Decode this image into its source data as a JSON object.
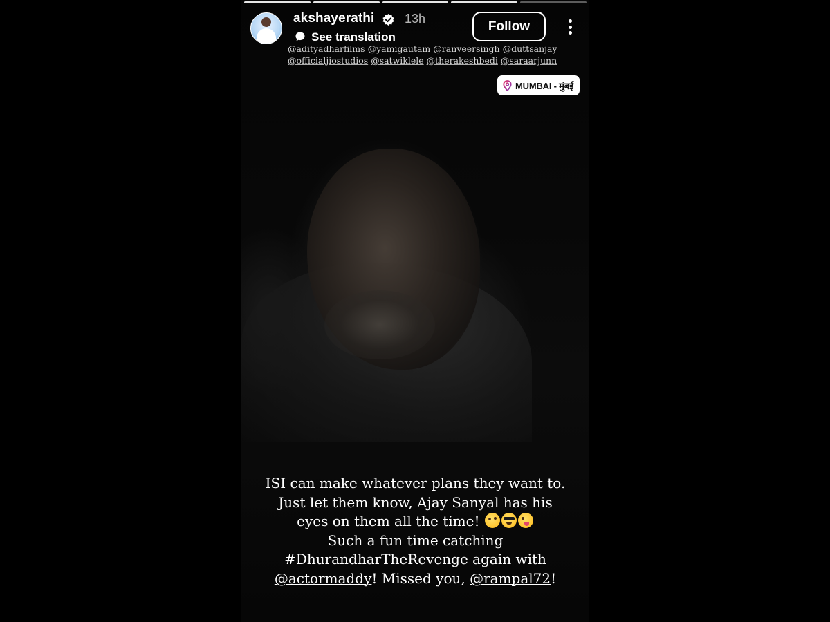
{
  "story": {
    "segments": [
      {
        "done": true
      },
      {
        "done": true
      },
      {
        "done": true
      },
      {
        "done": true
      },
      {
        "done": false
      }
    ],
    "header": {
      "username": "akshayerathi",
      "verified": true,
      "time_ago": "13h",
      "translate_label": "See translation",
      "follow_label": "Follow"
    },
    "mentions": {
      "row1": [
        "@adityadharfilms",
        "@yamigautam",
        "@ranveersingh",
        "@duttsanjay"
      ],
      "row2": [
        "@officialjiostudios",
        "@satwiklele",
        "@therakeshbedi",
        "@saraarjunn"
      ]
    },
    "location": {
      "label": "MUMBAI - मुंबई",
      "icon": "location-pin-icon"
    },
    "caption": {
      "line1": "ISI can make whatever plans they want to.",
      "line2": "Just let them know, Ajay Sanyal has his",
      "line3_text": "eyes on them all the time!",
      "line3_emojis": [
        "wink-emoji",
        "sunglasses-emoji",
        "winking-tongue-emoji"
      ],
      "line4": "Such a fun time catching",
      "hashtag": "#DhurandharTheRevenge",
      "line5_after": " again with",
      "mention1": "@actormaddy",
      "line6_middle": "! Missed you, ",
      "mention2": "@rampal72",
      "line6_end": "!"
    }
  },
  "colors": {
    "background": "#000000",
    "text": "#ffffff",
    "location_sticker_bg": "#ffffff",
    "verified_badge": "#ffffff",
    "location_pin": "#c13584"
  }
}
